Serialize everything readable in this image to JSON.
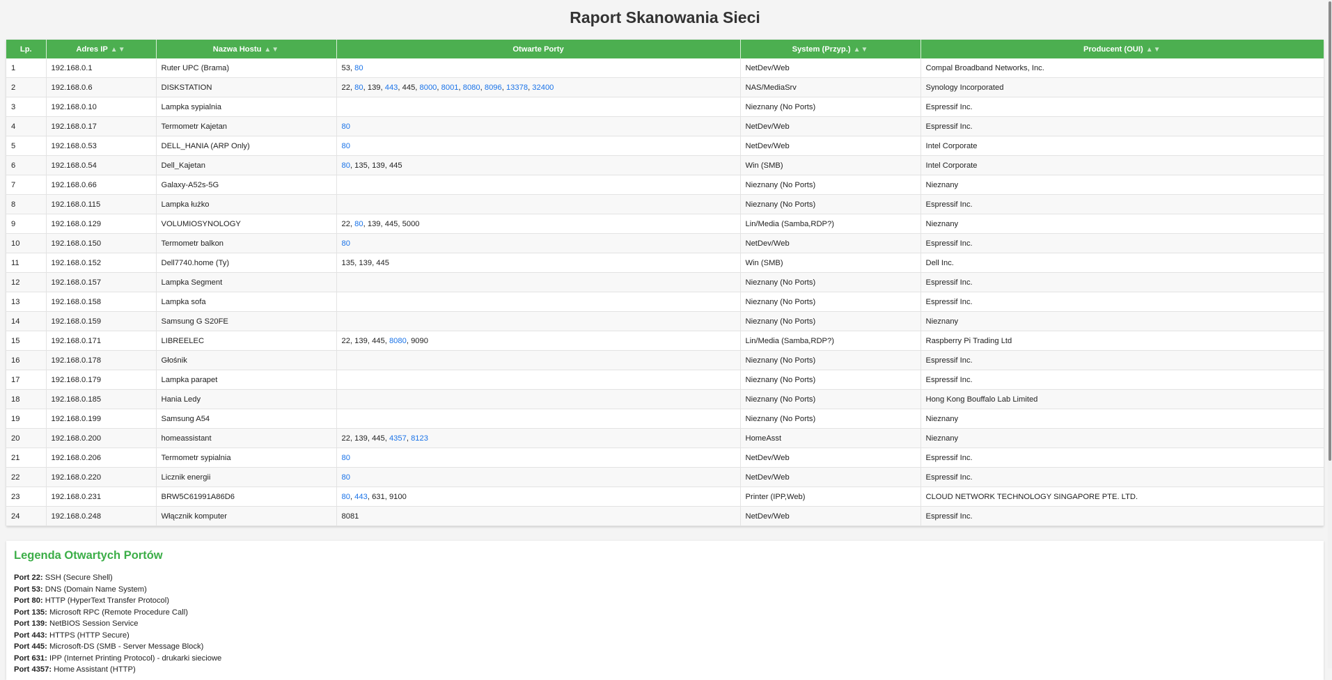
{
  "page": {
    "title": "Raport Skanowania Sieci"
  },
  "table": {
    "headers": [
      {
        "label": "Lp.",
        "sortable": false
      },
      {
        "label": "Adres IP",
        "sortable": true
      },
      {
        "label": "Nazwa Hostu",
        "sortable": true
      },
      {
        "label": "Otwarte Porty",
        "sortable": false
      },
      {
        "label": "System (Przyp.)",
        "sortable": true
      },
      {
        "label": "Producent (OUI)",
        "sortable": true
      }
    ],
    "sort_glyph": "▲▼",
    "rows": [
      {
        "lp": "1",
        "ip": "192.168.0.1",
        "host": "Ruter UPC (Brama)",
        "ports": [
          "53",
          "80"
        ],
        "system": "NetDev/Web",
        "vendor": "Compal Broadband Networks, Inc."
      },
      {
        "lp": "2",
        "ip": "192.168.0.6",
        "host": "DISKSTATION",
        "ports": [
          "22",
          "80",
          "139",
          "443",
          "445",
          "8000",
          "8001",
          "8080",
          "8096",
          "13378",
          "32400"
        ],
        "system": "NAS/MediaSrv",
        "vendor": "Synology Incorporated"
      },
      {
        "lp": "3",
        "ip": "192.168.0.10",
        "host": "Lampka sypialnia",
        "ports": [],
        "system": "Nieznany (No Ports)",
        "vendor": "Espressif Inc."
      },
      {
        "lp": "4",
        "ip": "192.168.0.17",
        "host": "Termometr Kajetan",
        "ports": [
          "80"
        ],
        "system": "NetDev/Web",
        "vendor": "Espressif Inc."
      },
      {
        "lp": "5",
        "ip": "192.168.0.53",
        "host": "DELL_HANIA (ARP Only)",
        "ports": [
          "80"
        ],
        "system": "NetDev/Web",
        "vendor": "Intel Corporate"
      },
      {
        "lp": "6",
        "ip": "192.168.0.54",
        "host": "Dell_Kajetan",
        "ports": [
          "80",
          "135",
          "139",
          "445"
        ],
        "system": "Win (SMB)",
        "vendor": "Intel Corporate"
      },
      {
        "lp": "7",
        "ip": "192.168.0.66",
        "host": "Galaxy-A52s-5G",
        "ports": [],
        "system": "Nieznany (No Ports)",
        "vendor": "Nieznany"
      },
      {
        "lp": "8",
        "ip": "192.168.0.115",
        "host": "Lampka łużko",
        "ports": [],
        "system": "Nieznany (No Ports)",
        "vendor": "Espressif Inc."
      },
      {
        "lp": "9",
        "ip": "192.168.0.129",
        "host": "VOLUMIOSYNOLOGY",
        "ports": [
          "22",
          "80",
          "139",
          "445",
          "5000"
        ],
        "system": "Lin/Media (Samba,RDP?)",
        "vendor": "Nieznany"
      },
      {
        "lp": "10",
        "ip": "192.168.0.150",
        "host": "Termometr balkon",
        "ports": [
          "80"
        ],
        "system": "NetDev/Web",
        "vendor": "Espressif Inc."
      },
      {
        "lp": "11",
        "ip": "192.168.0.152",
        "host": "Dell7740.home (Ty)",
        "ports": [
          "135",
          "139",
          "445"
        ],
        "system": "Win (SMB)",
        "vendor": "Dell Inc."
      },
      {
        "lp": "12",
        "ip": "192.168.0.157",
        "host": "Lampka Segment",
        "ports": [],
        "system": "Nieznany (No Ports)",
        "vendor": "Espressif Inc."
      },
      {
        "lp": "13",
        "ip": "192.168.0.158",
        "host": "Lampka sofa",
        "ports": [],
        "system": "Nieznany (No Ports)",
        "vendor": "Espressif Inc."
      },
      {
        "lp": "14",
        "ip": "192.168.0.159",
        "host": "Samsung G S20FE",
        "ports": [],
        "system": "Nieznany (No Ports)",
        "vendor": "Nieznany"
      },
      {
        "lp": "15",
        "ip": "192.168.0.171",
        "host": "LIBREELEC",
        "ports": [
          "22",
          "139",
          "445",
          "8080",
          "9090"
        ],
        "system": "Lin/Media (Samba,RDP?)",
        "vendor": "Raspberry Pi Trading Ltd"
      },
      {
        "lp": "16",
        "ip": "192.168.0.178",
        "host": "Głośnik",
        "ports": [],
        "system": "Nieznany (No Ports)",
        "vendor": "Espressif Inc."
      },
      {
        "lp": "17",
        "ip": "192.168.0.179",
        "host": "Lampka parapet",
        "ports": [],
        "system": "Nieznany (No Ports)",
        "vendor": "Espressif Inc."
      },
      {
        "lp": "18",
        "ip": "192.168.0.185",
        "host": "Hania Ledy",
        "ports": [],
        "system": "Nieznany (No Ports)",
        "vendor": "Hong Kong Bouffalo Lab Limited"
      },
      {
        "lp": "19",
        "ip": "192.168.0.199",
        "host": "Samsung A54",
        "ports": [],
        "system": "Nieznany (No Ports)",
        "vendor": "Nieznany"
      },
      {
        "lp": "20",
        "ip": "192.168.0.200",
        "host": "homeassistant",
        "ports": [
          "22",
          "139",
          "445",
          "4357",
          "8123"
        ],
        "system": "HomeAsst",
        "vendor": "Nieznany"
      },
      {
        "lp": "21",
        "ip": "192.168.0.206",
        "host": "Termometr sypialnia",
        "ports": [
          "80"
        ],
        "system": "NetDev/Web",
        "vendor": "Espressif Inc."
      },
      {
        "lp": "22",
        "ip": "192.168.0.220",
        "host": "Licznik energii",
        "ports": [
          "80"
        ],
        "system": "NetDev/Web",
        "vendor": "Espressif Inc."
      },
      {
        "lp": "23",
        "ip": "192.168.0.231",
        "host": "BRW5C61991A86D6",
        "ports": [
          "80",
          "443",
          "631",
          "9100"
        ],
        "system": "Printer (IPP,Web)",
        "vendor": "CLOUD NETWORK TECHNOLOGY SINGAPORE PTE. LTD."
      },
      {
        "lp": "24",
        "ip": "192.168.0.248",
        "host": "Włącznik komputer",
        "ports": [
          "8081"
        ],
        "system": "NetDev/Web",
        "vendor": "Espressif Inc."
      }
    ],
    "link_ports": [
      "80",
      "443",
      "8000",
      "8001",
      "8080",
      "8096",
      "13378",
      "32400",
      "4357",
      "8123"
    ],
    "colors": {
      "header_bg": "#4caf50",
      "link": "#1a73e8"
    }
  },
  "legend": {
    "title": "Legenda Otwartych Portów",
    "items": [
      {
        "port": "Port 22:",
        "desc": "SSH (Secure Shell)"
      },
      {
        "port": "Port 53:",
        "desc": "DNS (Domain Name System)"
      },
      {
        "port": "Port 80:",
        "desc": "HTTP (HyperText Transfer Protocol)"
      },
      {
        "port": "Port 135:",
        "desc": "Microsoft RPC (Remote Procedure Call)"
      },
      {
        "port": "Port 139:",
        "desc": "NetBIOS Session Service"
      },
      {
        "port": "Port 443:",
        "desc": "HTTPS (HTTP Secure)"
      },
      {
        "port": "Port 445:",
        "desc": "Microsoft-DS (SMB - Server Message Block)"
      },
      {
        "port": "Port 631:",
        "desc": "IPP (Internet Printing Protocol) - drukarki sieciowe"
      },
      {
        "port": "Port 4357:",
        "desc": "Home Assistant (HTTP)"
      }
    ]
  }
}
